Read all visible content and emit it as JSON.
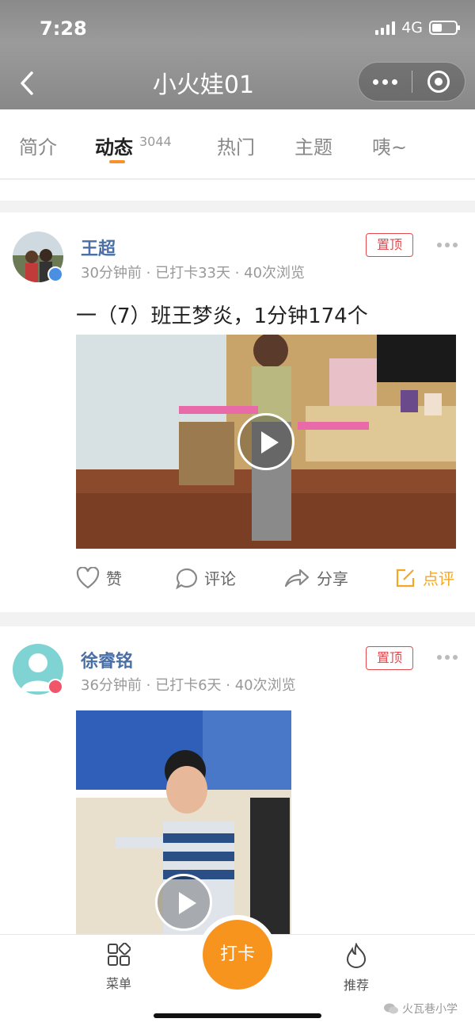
{
  "status_bar": {
    "time": "7:28",
    "network": "4G"
  },
  "header": {
    "title": "小火娃01"
  },
  "tabs": [
    {
      "label": "简介"
    },
    {
      "label": "动态",
      "count": "3044"
    },
    {
      "label": "热门"
    },
    {
      "label": "主题"
    },
    {
      "label": "咦~"
    }
  ],
  "posts": [
    {
      "user": "王超",
      "time": "30分钟前",
      "checkin": "已打卡33天",
      "views": "40次浏览",
      "pinned_label": "置顶",
      "text": "一（7）班王梦炎，1分钟174个",
      "badge_color": "#4a90e2"
    },
    {
      "user": "徐睿铭",
      "time": "36分钟前",
      "checkin": "已打卡6天",
      "views": "40次浏览",
      "pinned_label": "置顶",
      "badge_color": "#f0566a"
    }
  ],
  "actions": {
    "like": "赞",
    "comment": "评论",
    "share": "分享",
    "review": "点评"
  },
  "bottom_nav": {
    "menu": "菜单",
    "checkin": "打卡",
    "recommend": "推荐"
  },
  "watermark": "火瓦巷小学",
  "colors": {
    "accent": "#f7941d",
    "pin": "#e5484d",
    "username": "#4a6fa5"
  }
}
